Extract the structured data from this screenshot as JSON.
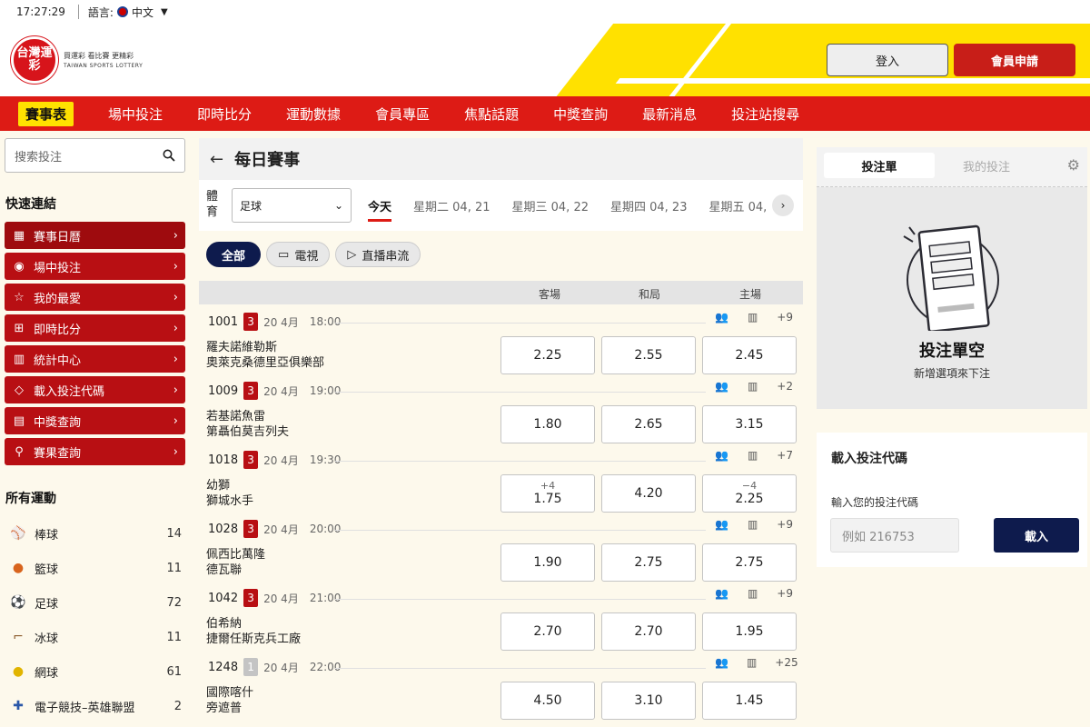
{
  "topbar": {
    "time": "17:27:29",
    "lang_label": "語言:",
    "lang_value": "中文"
  },
  "header": {
    "logo_text": "台灣運彩",
    "logo_slogan": "買運彩 看比賽 更精彩",
    "logo_en": "TAIWAN SPORTS LOTTERY",
    "login_label": "登入",
    "register_label": "會員申請"
  },
  "nav": [
    "賽事表",
    "場中投注",
    "即時比分",
    "運動數據",
    "會員專區",
    "焦點話題",
    "中獎查詢",
    "最新消息",
    "投注站搜尋"
  ],
  "sidebar": {
    "search_placeholder": "搜索投注",
    "quick_title": "快速連結",
    "quick_links": [
      {
        "label": "賽事日曆",
        "icon": "calendar-icon"
      },
      {
        "label": "場中投注",
        "icon": "live-signal-icon"
      },
      {
        "label": "我的最愛",
        "icon": "star-icon"
      },
      {
        "label": "即時比分",
        "icon": "scoreboard-icon"
      },
      {
        "label": "統計中心",
        "icon": "bar-chart-icon"
      },
      {
        "label": "載入投注代碼",
        "icon": "ticket-icon"
      },
      {
        "label": "中獎查詢",
        "icon": "clipboard-icon"
      },
      {
        "label": "賽果查詢",
        "icon": "search-icon"
      }
    ],
    "sports_title": "所有運動",
    "sports": [
      {
        "label": "棒球",
        "count": "14",
        "icon": "baseball-icon"
      },
      {
        "label": "籃球",
        "count": "11",
        "icon": "basketball-icon"
      },
      {
        "label": "足球",
        "count": "72",
        "icon": "soccer-icon"
      },
      {
        "label": "冰球",
        "count": "11",
        "icon": "hockey-icon"
      },
      {
        "label": "網球",
        "count": "61",
        "icon": "tennis-icon"
      },
      {
        "label": "電子競技–英雄聯盟",
        "count": "2",
        "icon": "gamepad-icon"
      }
    ]
  },
  "main": {
    "title": "每日賽事",
    "sport_label": "體育",
    "sport_value": "足球",
    "days": [
      "今天",
      "星期二 04, 21",
      "星期三 04, 22",
      "星期四 04, 23",
      "星期五 04,"
    ],
    "filters": [
      "全部",
      "電視",
      "直播串流"
    ],
    "columns": [
      "客場",
      "和局",
      "主場"
    ],
    "matches": [
      {
        "no": "1001",
        "badge": "3",
        "date": "20 4月",
        "time": "18:00",
        "more": "+9",
        "away": "羅夫諾維勒斯",
        "home": "奧萊克桑德里亞俱樂部",
        "odds": [
          {
            "hc": "",
            "v": "2.25"
          },
          {
            "hc": "",
            "v": "2.55"
          },
          {
            "hc": "",
            "v": "2.45"
          }
        ]
      },
      {
        "no": "1009",
        "badge": "3",
        "date": "20 4月",
        "time": "19:00",
        "more": "+2",
        "away": "若基諾魚雷",
        "home": "第聶伯莫吉列夫",
        "odds": [
          {
            "hc": "",
            "v": "1.80"
          },
          {
            "hc": "",
            "v": "2.65"
          },
          {
            "hc": "",
            "v": "3.15"
          }
        ]
      },
      {
        "no": "1018",
        "badge": "3",
        "date": "20 4月",
        "time": "19:30",
        "more": "+7",
        "away": "幼獅",
        "home": "獅城水手",
        "odds": [
          {
            "hc": "+4",
            "v": "1.75"
          },
          {
            "hc": "",
            "v": "4.20"
          },
          {
            "hc": "−4",
            "v": "2.25"
          }
        ]
      },
      {
        "no": "1028",
        "badge": "3",
        "date": "20 4月",
        "time": "20:00",
        "more": "+9",
        "away": "佩西比萬隆",
        "home": "德瓦聯",
        "odds": [
          {
            "hc": "",
            "v": "1.90"
          },
          {
            "hc": "",
            "v": "2.75"
          },
          {
            "hc": "",
            "v": "2.75"
          }
        ]
      },
      {
        "no": "1042",
        "badge": "3",
        "date": "20 4月",
        "time": "21:00",
        "more": "+9",
        "away": "伯希納",
        "home": "捷爾任斯克兵工廠",
        "odds": [
          {
            "hc": "",
            "v": "2.70"
          },
          {
            "hc": "",
            "v": "2.70"
          },
          {
            "hc": "",
            "v": "1.95"
          }
        ]
      },
      {
        "no": "1248",
        "badge": "1",
        "date": "20 4月",
        "time": "22:00",
        "more": "+25",
        "away": "國際喀什",
        "home": "旁遮普",
        "odds": [
          {
            "hc": "",
            "v": "4.50"
          },
          {
            "hc": "",
            "v": "3.10"
          },
          {
            "hc": "",
            "v": "1.45"
          }
        ]
      }
    ]
  },
  "betslip": {
    "tab_slip": "投注單",
    "tab_mine": "我的投注",
    "empty_title": "投注單空",
    "empty_sub": "新增選項來下注"
  },
  "code": {
    "title": "載入投注代碼",
    "label": "輸入您的投注代碼",
    "placeholder": "例如 216753",
    "button": "載入"
  }
}
